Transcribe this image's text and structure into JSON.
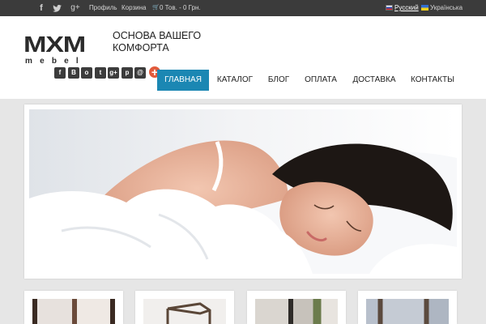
{
  "topbar": {
    "social_icons": [
      "apple-icon",
      "facebook-icon",
      "twitter-icon",
      "google-plus-icon"
    ],
    "glyphs": {
      "apple": "",
      "facebook": "f",
      "twitter": "t",
      "google_plus": "g+"
    },
    "profile": "Профиль",
    "cart": "Корзина",
    "cart_glyph": "🛒",
    "cart_summary": "0 Тов. - 0 Грн.",
    "lang_ru": "Русский",
    "lang_ua": "Українська"
  },
  "header": {
    "logo_main": "MXM",
    "logo_sub": "mebel",
    "slogan": "ОСНОВА ВАШЕГО КОМФОРТА"
  },
  "share": {
    "buttons": [
      {
        "icon": "facebook-icon",
        "glyph": "f"
      },
      {
        "icon": "vkontakte-icon",
        "glyph": "B"
      },
      {
        "icon": "odnoklassniki-icon",
        "glyph": "o"
      },
      {
        "icon": "twitter-icon",
        "glyph": "t"
      },
      {
        "icon": "google-plus-icon",
        "glyph": "g+"
      },
      {
        "icon": "pinterest-icon",
        "glyph": "p"
      },
      {
        "icon": "email-icon",
        "glyph": "@"
      }
    ],
    "more_glyph": "+"
  },
  "nav": {
    "items": [
      "ГЛАВНАЯ",
      "КАТАЛОГ",
      "БЛОГ",
      "ОПЛАТА",
      "ДОСТАВКА",
      "КОНТАКТЫ"
    ],
    "active_index": 0
  },
  "colors": {
    "topbar": "#3b3b3b",
    "accent": "#1b87b3",
    "share_plus": "#e15a3b",
    "background": "#e6e6e6"
  }
}
